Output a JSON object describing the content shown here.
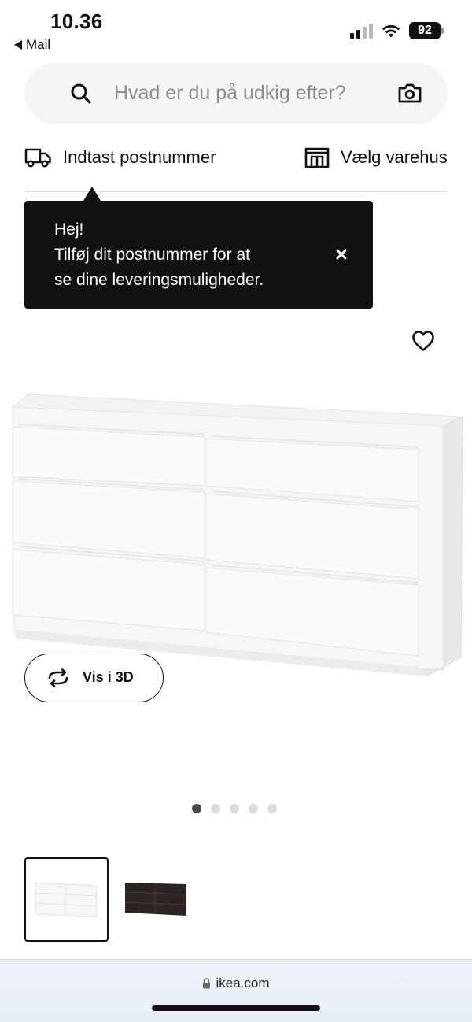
{
  "status_bar": {
    "time": "10.36",
    "back_app": "Mail",
    "battery": "92",
    "signal_bars_active": 2,
    "signal_bars_total": 4
  },
  "search": {
    "placeholder": "Hvad er du på udkig efter?",
    "icon": "search-icon",
    "camera_icon": "camera-icon"
  },
  "delivery": {
    "postcode_label": "Indtast postnummer",
    "store_label": "Vælg varehus",
    "postcode_icon": "truck-icon",
    "store_icon": "store-icon"
  },
  "tooltip": {
    "lines": [
      "Hej!",
      "Tilføj dit postnummer for at",
      "se dine leveringsmuligheder."
    ]
  },
  "product": {
    "view_3d_label": "Vis i 3D",
    "image_count": 5,
    "active_image_index": 0,
    "variants": [
      {
        "color": "#f4f4f4",
        "selected": true
      },
      {
        "color": "#2b2422",
        "selected": false
      }
    ]
  },
  "browser": {
    "url": "ikea.com",
    "lock_icon": "lock-icon"
  },
  "colors": {
    "tooltip_bg": "#111111",
    "search_bg": "#f5f5f5",
    "dot_active": "#484848",
    "dot_inactive": "#dcdcdc"
  }
}
